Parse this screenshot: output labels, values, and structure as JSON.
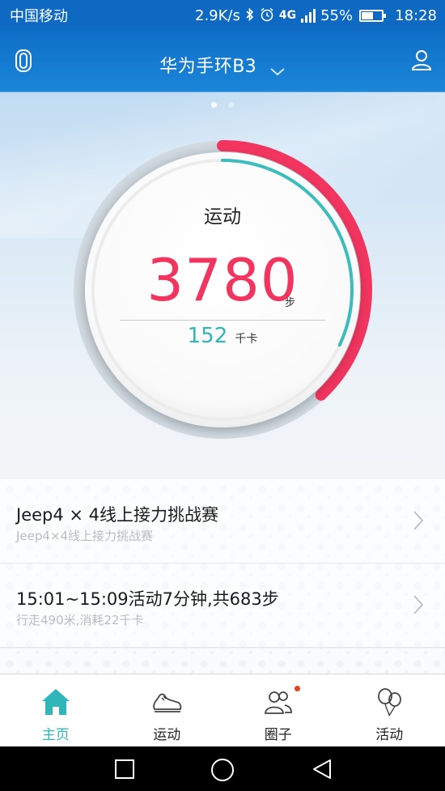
{
  "status_bar": {
    "carrier": "中国移动",
    "speed": "2.9K/s",
    "network": "4G",
    "battery": "55%",
    "time": "18:28"
  },
  "header": {
    "title": "华为手环B3"
  },
  "pager": {
    "count": 2,
    "active": 0
  },
  "gauge": {
    "title": "运动",
    "steps": "3780",
    "steps_unit": "步",
    "kcal": "152",
    "kcal_unit": "千卡",
    "steps_progress": 0.38,
    "kcal_progress": 0.32
  },
  "list": {
    "items": [
      {
        "title": "Jeep4 × 4线上接力挑战赛",
        "subtitle": "Jeep4×4线上接力挑战赛"
      },
      {
        "title": "15:01~15:09活动7分钟,共683步",
        "subtitle": "行走490米,消耗22千卡"
      }
    ]
  },
  "bottom_nav": {
    "items": [
      {
        "label": "主页",
        "icon": "home-icon"
      },
      {
        "label": "运动",
        "icon": "shoe-icon"
      },
      {
        "label": "圈子",
        "icon": "people-icon"
      },
      {
        "label": "活动",
        "icon": "balloons-icon"
      }
    ]
  },
  "colors": {
    "accent_red": "#f2355f",
    "accent_teal": "#2fb6b9",
    "header_blue": "#1a86d8"
  }
}
